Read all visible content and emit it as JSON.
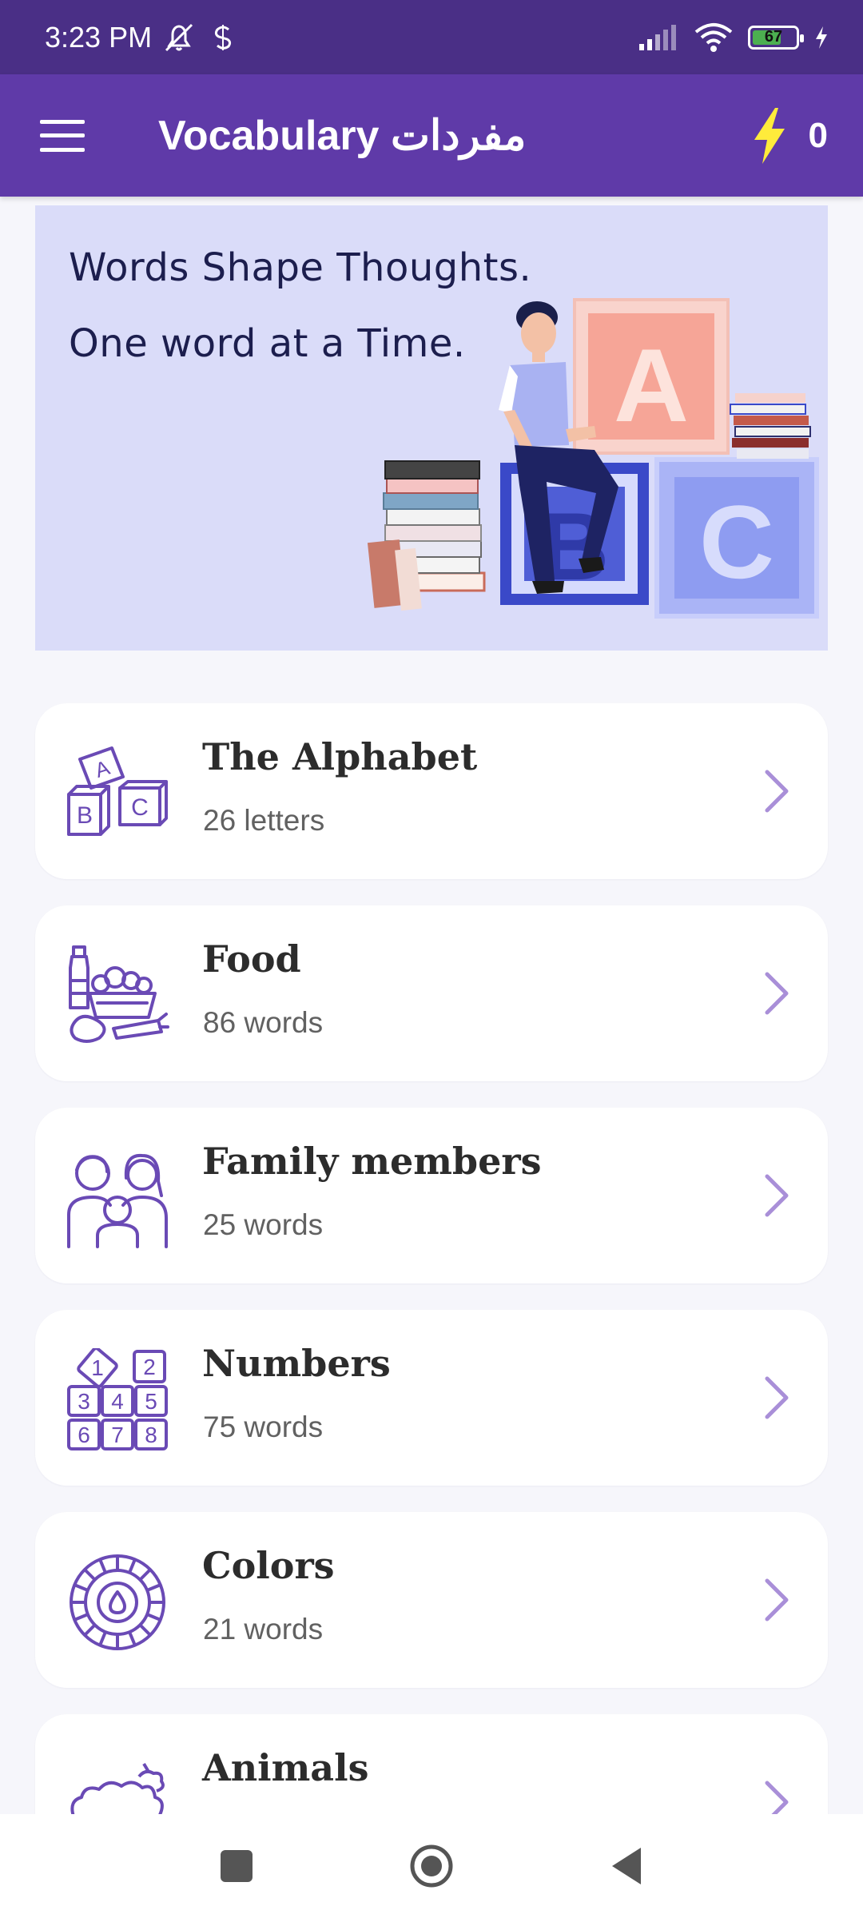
{
  "status": {
    "time": "3:23 PM",
    "battery_level": "67",
    "battery_fraction": 0.67
  },
  "app_bar": {
    "title": "Vocabulary مفردات",
    "points": "0"
  },
  "banner": {
    "line1": "Words Shape Thoughts.",
    "line2": "One word at a Time.",
    "block_letters": [
      "A",
      "B",
      "C"
    ]
  },
  "categories": [
    {
      "title": "The Alphabet",
      "count": "26 letters",
      "icon": "alphabet-blocks-icon"
    },
    {
      "title": "Food",
      "count": "86 words",
      "icon": "food-basket-icon"
    },
    {
      "title": "Family members",
      "count": "25 words",
      "icon": "family-icon"
    },
    {
      "title": "Numbers",
      "count": "75 words",
      "icon": "number-blocks-icon"
    },
    {
      "title": "Colors",
      "count": "21 words",
      "icon": "color-wheel-icon"
    },
    {
      "title": "Animals",
      "count": "",
      "icon": "sheep-icon"
    }
  ],
  "colors": {
    "status_bar": "#4a2f86",
    "app_bar": "#5f3aa8",
    "banner_bg": "#dadcf9",
    "icon_stroke": "#6a4ab5",
    "chevron": "#a98fd8",
    "bolt": "#ffeb3b"
  },
  "icon_names": {
    "block_letter": "letter-A",
    "block_letter_b": "letter-B",
    "block_letter_c": "letter-C",
    "n1": "1",
    "n2": "2",
    "n3": "3",
    "n4": "4",
    "n5": "5",
    "n6": "6",
    "n7": "7",
    "n8": "8"
  }
}
